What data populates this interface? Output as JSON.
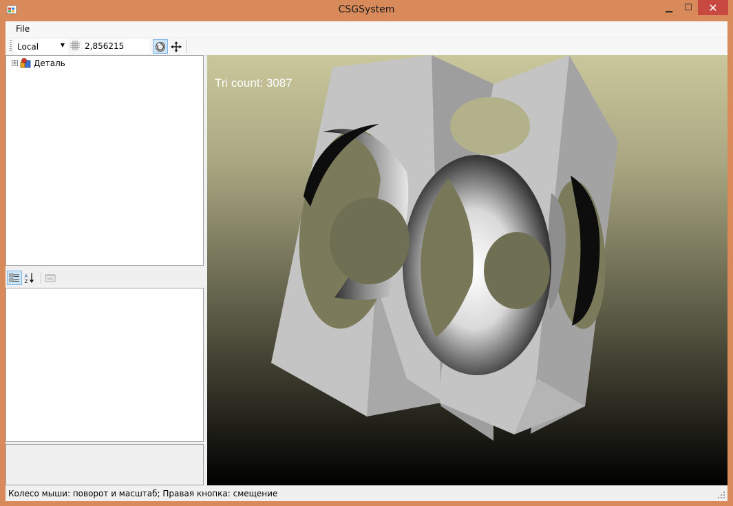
{
  "window": {
    "title": "CSGSystem",
    "minimize_glyph": "▁",
    "maximize_glyph": "☐",
    "close_glyph": "✕"
  },
  "menu": {
    "file_label": "File"
  },
  "toolbar": {
    "coordinate_space": "Local",
    "grid_size_value": "2,856215",
    "icons": [
      "grid-icon",
      "rotate-icon",
      "move-icon"
    ]
  },
  "scene_tree": {
    "nodes": [
      {
        "label": "Деталь",
        "expander": "+",
        "icon": "part-icon"
      }
    ]
  },
  "property_grid": {
    "toolbar_icons": [
      "categorized-icon",
      "alphabetical-icon",
      "property-pages-icon"
    ]
  },
  "viewport": {
    "tri_count_label": "Tri count: 3087",
    "colors": {
      "background_top": "#c9c69b",
      "background_bottom": "#000000",
      "solid": "#c3c3c3"
    }
  },
  "status": {
    "hint": "Колесо мыши: поворот и масштаб; Правая кнопка: смещение"
  }
}
